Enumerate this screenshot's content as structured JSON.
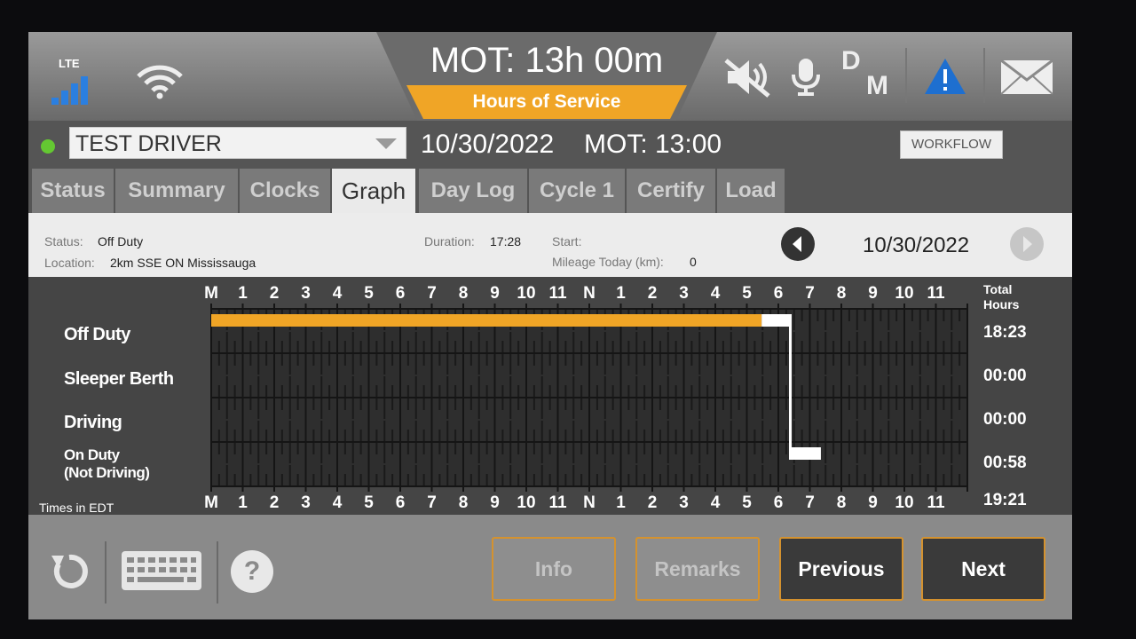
{
  "top": {
    "network_label": "LTE",
    "mot_clock": "MOT: 13h 00m",
    "section_title": "Hours of Service",
    "dm_d": "D",
    "dm_m": "M"
  },
  "header": {
    "driver_name": "TEST DRIVER",
    "date": "10/30/2022",
    "mot": "MOT: 13:00",
    "workflow_label": "WORKFLOW"
  },
  "tabs": [
    {
      "label": "Status",
      "active": false
    },
    {
      "label": "Summary",
      "active": false
    },
    {
      "label": "Clocks",
      "active": false
    },
    {
      "label": "Graph",
      "active": true
    },
    {
      "label": "Day Log",
      "active": false
    },
    {
      "label": "Cycle 1",
      "active": false
    },
    {
      "label": "Certify",
      "active": false
    },
    {
      "label": "Load",
      "active": false
    }
  ],
  "info": {
    "status_label": "Status:",
    "status_value": "Off Duty",
    "location_label": "Location:",
    "location_value": "2km SSE ON Mississauga",
    "duration_label": "Duration:",
    "duration_value": "17:28",
    "start_label": "Start:",
    "mileage_label": "Mileage Today (km):",
    "mileage_value": "0",
    "nav_date": "10/30/2022"
  },
  "graph": {
    "hour_labels": [
      "M",
      "1",
      "2",
      "3",
      "4",
      "5",
      "6",
      "7",
      "8",
      "9",
      "10",
      "11",
      "N",
      "1",
      "2",
      "3",
      "4",
      "5",
      "6",
      "7",
      "8",
      "9",
      "10",
      "11"
    ],
    "rows": [
      {
        "label": "Off Duty",
        "total": "18:23"
      },
      {
        "label": "Sleeper Berth",
        "total": "00:00"
      },
      {
        "label": "Driving",
        "total": "00:00"
      },
      {
        "label_line1": "On Duty",
        "label_line2": "(Not Driving)",
        "total": "00:58"
      }
    ],
    "total_header_line1": "Total",
    "total_header_line2": "Hours",
    "grand_total": "19:21",
    "times_note": "Times in EDT",
    "segments": [
      {
        "status": "Off Duty",
        "start_hour": 0,
        "end_hour": 17.47,
        "color": "#f0a526"
      },
      {
        "status": "Off Duty",
        "start_hour": 17.47,
        "end_hour": 18.38,
        "color": "#ffffff"
      },
      {
        "status": "On Duty (Not Driving)",
        "start_hour": 18.38,
        "end_hour": 19.35,
        "color": "#ffffff"
      }
    ]
  },
  "bottom": {
    "info_label": "Info",
    "remarks_label": "Remarks",
    "previous_label": "Previous",
    "next_label": "Next"
  },
  "colors": {
    "accent_orange": "#f0a526",
    "status_green": "#64c832",
    "warning_blue": "#1e6fd0"
  }
}
